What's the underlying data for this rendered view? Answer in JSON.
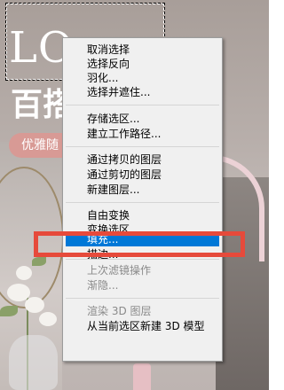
{
  "background": {
    "headline_en": "LO",
    "headline_cn": "百搭",
    "tag": "优雅随"
  },
  "context_menu": {
    "items": [
      {
        "label": "取消选择",
        "enabled": true
      },
      {
        "label": "选择反向",
        "enabled": true
      },
      {
        "label": "羽化...",
        "enabled": true
      },
      {
        "label": "选择并遮住...",
        "enabled": true
      },
      {
        "label": "存储选区...",
        "enabled": true
      },
      {
        "label": "建立工作路径...",
        "enabled": true
      },
      {
        "label": "通过拷贝的图层",
        "enabled": true
      },
      {
        "label": "通过剪切的图层",
        "enabled": true
      },
      {
        "label": "新建图层...",
        "enabled": true
      },
      {
        "label": "自由变换",
        "enabled": true
      },
      {
        "label": "变换选区",
        "enabled": true
      },
      {
        "label": "填充...",
        "enabled": true,
        "highlighted": true
      },
      {
        "label": "描边...",
        "enabled": true
      },
      {
        "label": "上次滤镜操作",
        "enabled": false
      },
      {
        "label": "渐隐...",
        "enabled": false
      },
      {
        "label": "渲染 3D 图层",
        "enabled": false
      },
      {
        "label": "从当前选区新建 3D 模型",
        "enabled": true
      }
    ]
  },
  "colors": {
    "menu_bg": "#f0f0f0",
    "highlight": "#0078d7",
    "annotation_red": "#e64a3b",
    "tag_pink": "#d89a95"
  }
}
